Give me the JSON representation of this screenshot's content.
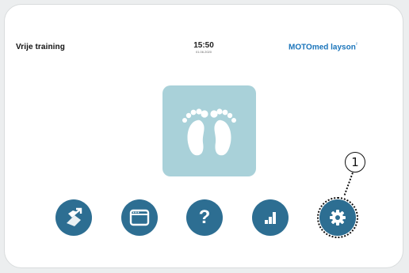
{
  "header": {
    "mode_title": "Vrije training",
    "time": "15:50",
    "date": "01.06.2020",
    "brand": "MOTOmed layson",
    "brand_mark": "²"
  },
  "main": {
    "mode_icon": "feet-icon"
  },
  "toolbar": {
    "buttons": [
      {
        "icon": "training-program-icon"
      },
      {
        "icon": "window-display-icon"
      },
      {
        "icon": "help-icon",
        "label": "?"
      },
      {
        "icon": "bar-chart-icon"
      },
      {
        "icon": "gear-icon"
      }
    ]
  },
  "annotation": {
    "callout_number": "1"
  },
  "colors": {
    "button": "#2d6e92",
    "tile": "#a9d1d9",
    "brand": "#1b75bb"
  }
}
